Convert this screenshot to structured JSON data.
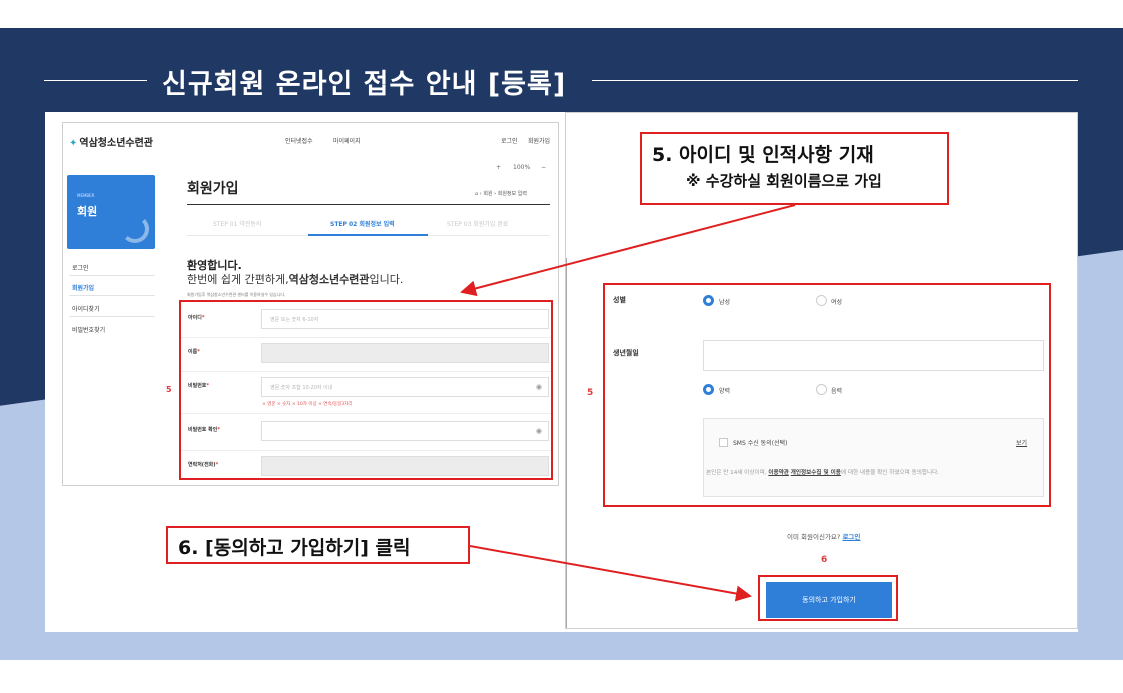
{
  "title": "신규회원 온라인 접수 안내 [등록]",
  "left_screen": {
    "logo": "역삼청소년수련관",
    "nav": [
      "인터넷접수",
      "마이페이지"
    ],
    "util": [
      "로그인",
      "회원가입"
    ],
    "zoom": {
      "plus": "+",
      "level": "100%",
      "minus": "−"
    },
    "member_box": {
      "en": "MEMBER",
      "ko": "회원"
    },
    "sidebar": [
      "로그인",
      "회원가입",
      "아이디찾기",
      "비밀번호찾기"
    ],
    "page_title": "회원가입",
    "breadcrumb": "⌂ › 회원 › 회원정보 입력",
    "steps": [
      "STEP 01  약관동의",
      "STEP 02  회원정보 입력",
      "STEP 03  회원가입 완료"
    ],
    "welcome": "환영합니다.",
    "welcome_line_pre": "한번에 쉽게 간편하게,",
    "welcome_line_bold": "역삼청소년수련관",
    "welcome_line_post": "입니다.",
    "welcome_note": "회원가입후 역삼청소년수련관 센터를 이용하실수 있습니다.",
    "form": {
      "id_label": "아이디",
      "id_placeholder": "영문 또는 숫자 6-10자",
      "name_label": "이름",
      "pw_label": "비밀번호",
      "pw_placeholder": "영문,숫자 조합 10-20자 이내",
      "pw_rules": "× 영문   × 숫자   × 10자 이상   × 연속/동일3자리",
      "pw_confirm_label": "비밀번호 확인",
      "phone_label": "연락처(전화)",
      "required": "*"
    },
    "marker": "5"
  },
  "right_screen": {
    "gender_label": "성별",
    "male": "남성",
    "female": "여성",
    "birth_label": "생년월일",
    "solar": "양력",
    "lunar": "음력",
    "sms": "SMS 수신 동의(선택)",
    "view": "보기",
    "agree_pre": "본인은 만 14세 이상이며, ",
    "agree_terms": "이용약관",
    "agree_privacy": "개인정보수집 및 이용",
    "agree_post": "에 대한 내용을 확인 하였으며 동의합니다.",
    "already_member": "이미 회원이신가요?",
    "login_link": "로그인",
    "marker_5": "5",
    "marker_6": "6",
    "join_button": "동의하고 가입하기"
  },
  "callouts": {
    "step5_title": "5. 아이디 및 인적사항 기재",
    "step5_note": "※ 수강하실 회원이름으로 가입",
    "step6": "6. [동의하고 가입하기] 클릭"
  },
  "colors": {
    "navy": "#1f3864",
    "light_blue": "#b4c7e7",
    "accent_blue": "#2f7fd8",
    "annotation_red": "#e02020"
  }
}
